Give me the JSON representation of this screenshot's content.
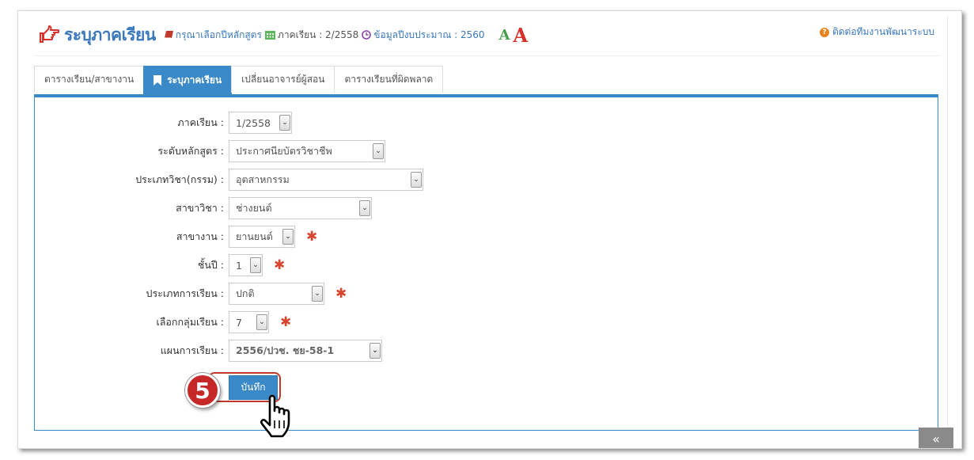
{
  "header": {
    "title": "ระบุภาคเรียน",
    "course_link": "กรุณาเลือกปีหลักสูตร",
    "semester_text": "ภาคเรียน : 2/2558",
    "budget_text": "ข้อมูลปีงบประมาณ : 2560",
    "font_small": "A",
    "font_big": "A",
    "contact": "ติดต่อทีมงานพัฒนาระบบ"
  },
  "tabs": [
    {
      "label": "ตารางเรียน/สาขางาน",
      "active": false
    },
    {
      "label": "ระบุภาคเรียน",
      "active": true
    },
    {
      "label": "เปลี่ยนอาจารย์ผู้สอน",
      "active": false
    },
    {
      "label": "ตารางเรียนที่ผิดพลาด",
      "active": false
    }
  ],
  "form": {
    "fields": [
      {
        "label": "ภาคเรียน :",
        "value": "1/2558",
        "required": false
      },
      {
        "label": "ระดับหลักสูตร :",
        "value": "ประกาศนียบัตรวิชาชีพ",
        "required": false
      },
      {
        "label": "ประเภทวิชา(กรรม) :",
        "value": "อุตสาหกรรม",
        "required": false
      },
      {
        "label": "สาขาวิชา :",
        "value": "ช่างยนต์",
        "required": false
      },
      {
        "label": "สาขางาน :",
        "value": "ยานยนต์",
        "required": true
      },
      {
        "label": "ชั้นปี :",
        "value": "1",
        "required": true
      },
      {
        "label": "ประเภทการเรียน :",
        "value": "ปกติ",
        "required": true
      },
      {
        "label": "เลือกกลุ่มเรียน :",
        "value": "7",
        "required": true
      },
      {
        "label": "แผนการเรียน :",
        "value": "2556/ปวช. ชย-58-1",
        "required": false
      }
    ],
    "required_mark": "✱",
    "save_label": "บันทึก"
  },
  "annotation": {
    "step": "5"
  },
  "scroll_top": "«",
  "colors": {
    "accent": "#3a89c9",
    "title": "#3a78bd",
    "required": "#d9452e",
    "step": "#c62828"
  }
}
